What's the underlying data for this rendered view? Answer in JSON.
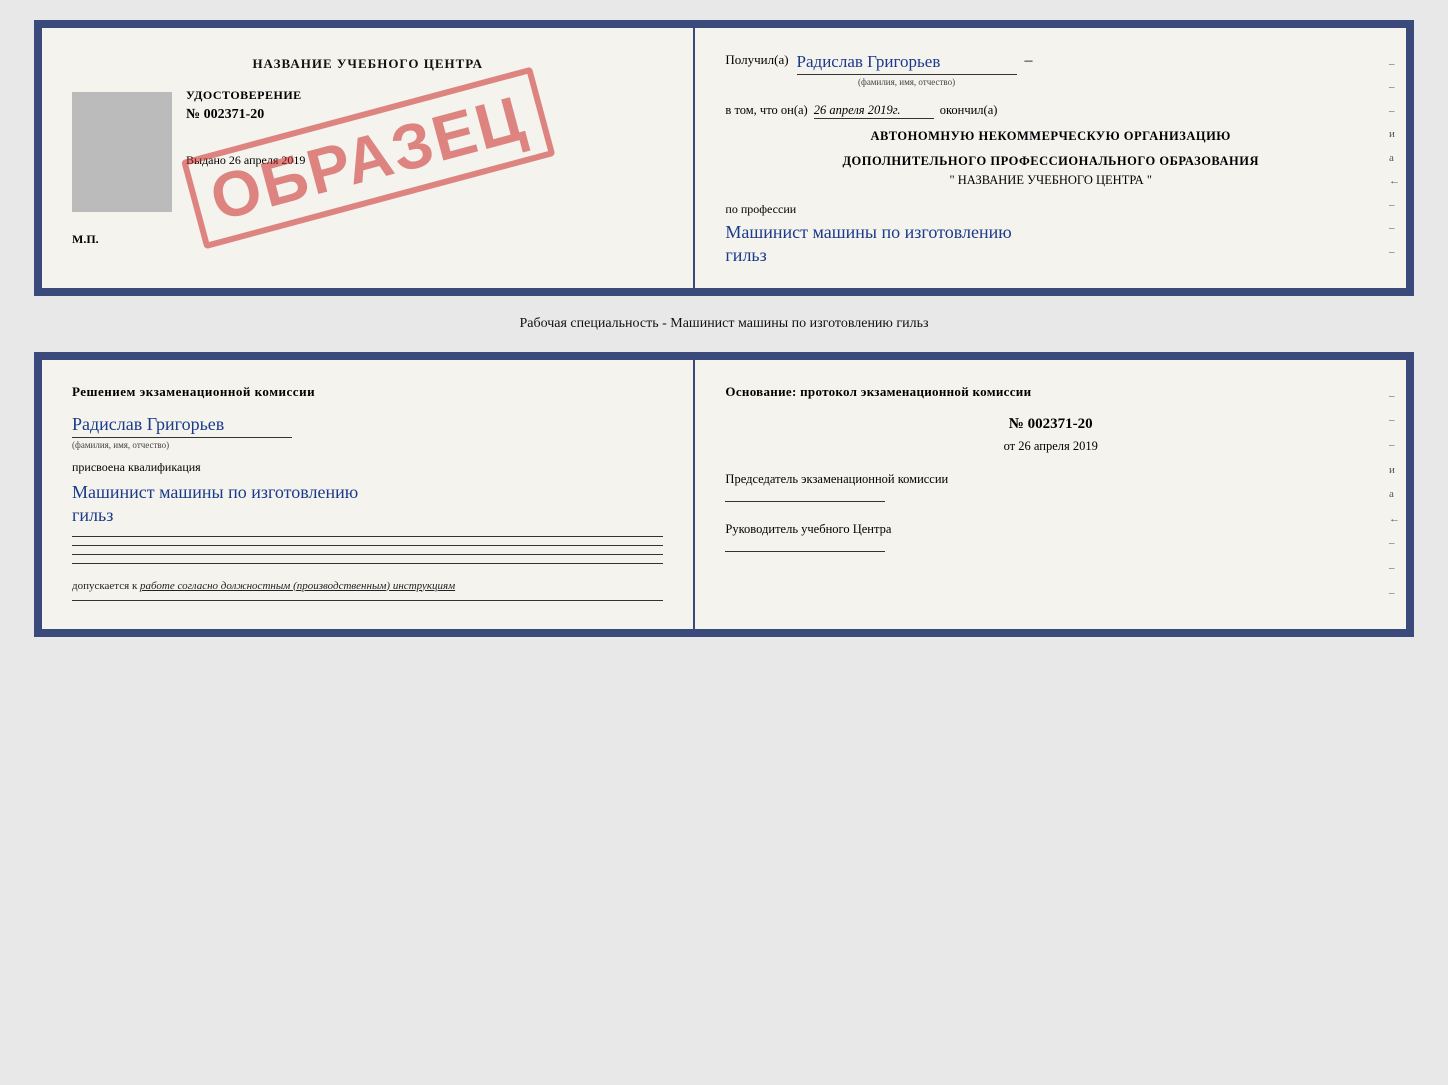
{
  "top_doc": {
    "left": {
      "title": "НАЗВАНИЕ УЧЕБНОГО ЦЕНТРА",
      "cert_label": "УДОСТОВЕРЕНИЕ",
      "cert_number": "№ 002371-20",
      "date_label": "Выдано",
      "date_value": "26 апреля 2019",
      "stamp": "ОБРАЗЕЦ",
      "mp": "М.П."
    },
    "right": {
      "received_label": "Получил(а)",
      "recipient_name": "Радислав Григорьев",
      "fio_sub": "(фамилия, имя, отчество)",
      "v_tom_label": "в том, что он(а)",
      "date_value": "26 апреля 2019г.",
      "okonchil": "окончил(а)",
      "org_line1": "АВТОНОМНУЮ НЕКОММЕРЧЕСКУЮ ОРГАНИЗАЦИЮ",
      "org_line2": "ДОПОЛНИТЕЛЬНОГО ПРОФЕССИОНАЛЬНОГО ОБРАЗОВАНИЯ",
      "org_name": "\" НАЗВАНИЕ УЧЕБНОГО ЦЕНТРА \"",
      "po_professii": "по профессии",
      "profession_line1": "Машинист машины по изготовлению",
      "profession_line2": "гильз",
      "side_marks": [
        "-",
        "-",
        "-",
        "и",
        "а",
        "←",
        "-",
        "-",
        "-"
      ]
    }
  },
  "specialty_label": "Рабочая специальность - Машинист машины по изготовлению гильз",
  "bottom_doc": {
    "left": {
      "title": "Решением экзаменационной комиссии",
      "name": "Радислав Григорьев",
      "fio_sub": "(фамилия, имя, отчество)",
      "prisvoena": "присвоена квалификация",
      "qual_line1": "Машинист машины по изготовлению",
      "qual_line2": "гильз",
      "dopusk": "допускается к",
      "dopusk_text": "работе согласно должностным (производственным) инструкциям"
    },
    "right": {
      "osnov_label": "Основание: протокол экзаменационной комиссии",
      "protocol_number": "№ 002371-20",
      "date_ot": "от",
      "date_value": "26 апреля 2019",
      "predsedatel_label": "Председатель экзаменационной комиссии",
      "rukovoditel_label": "Руководитель учебного Центра",
      "side_marks": [
        "-",
        "-",
        "-",
        "и",
        "а",
        "←",
        "-",
        "-",
        "-"
      ]
    }
  }
}
